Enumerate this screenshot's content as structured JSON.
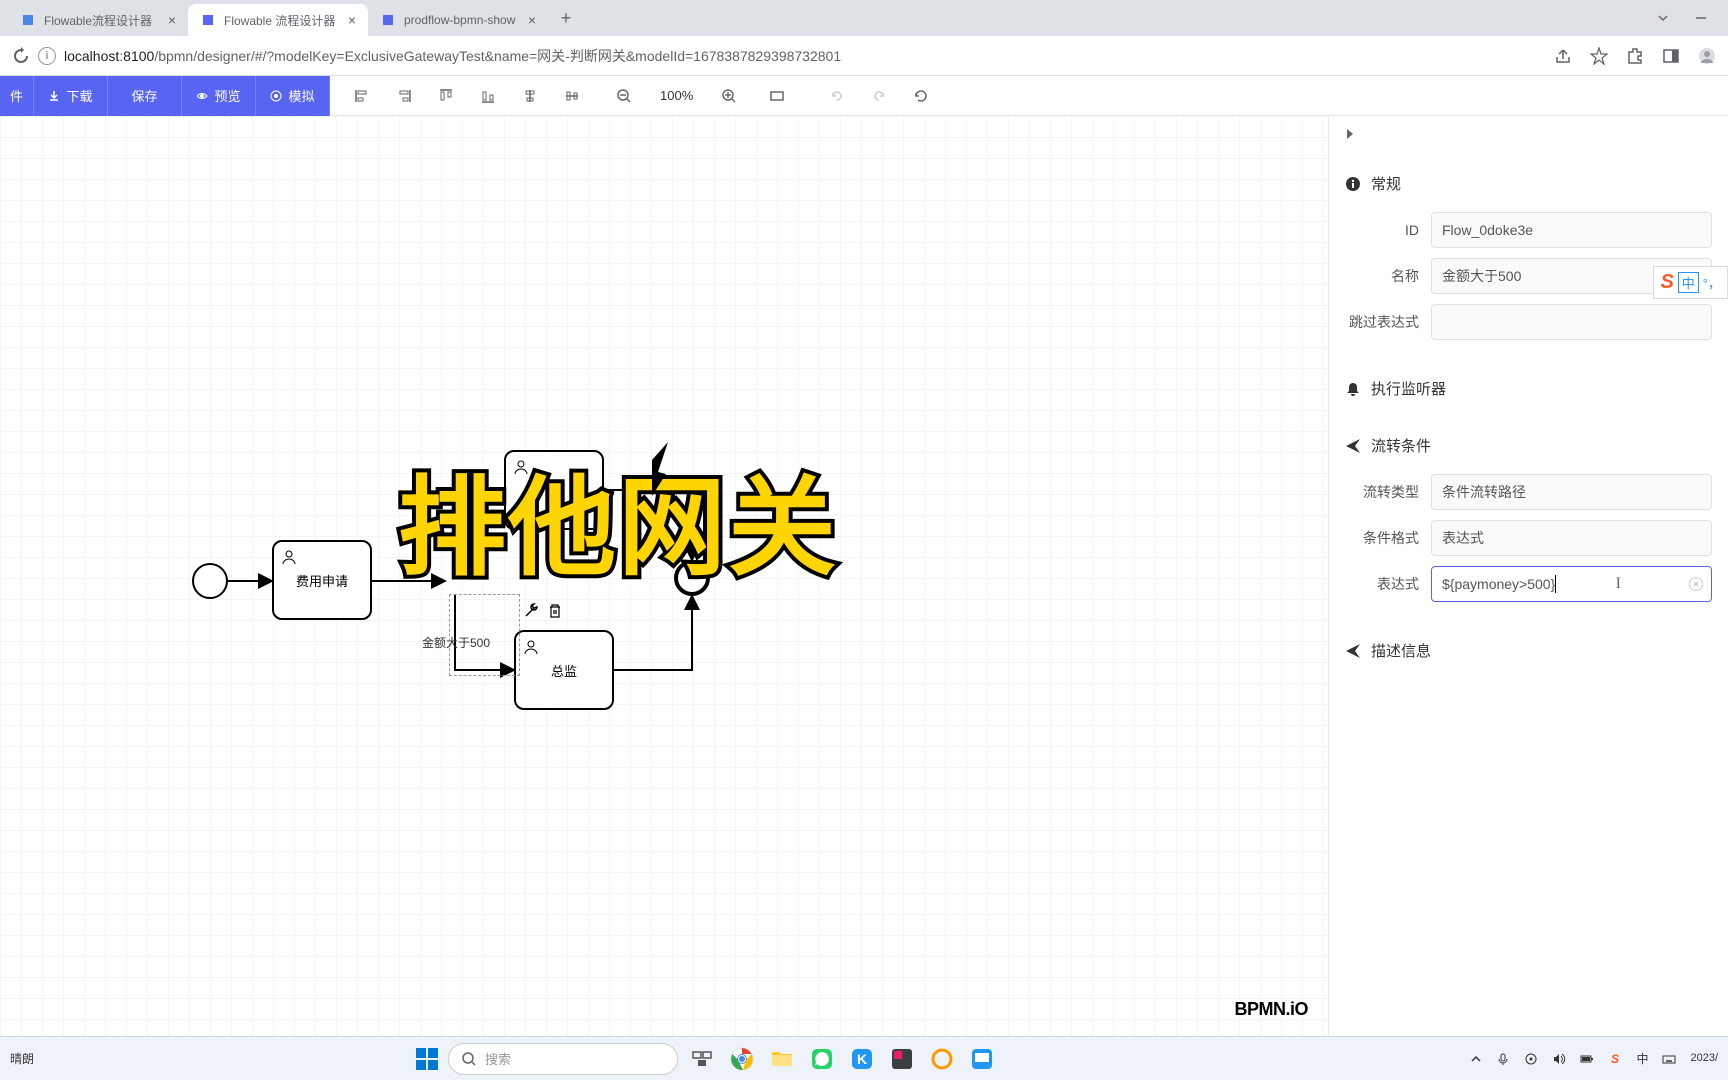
{
  "tabs": [
    {
      "title": "Flowable流程设计器",
      "active": false
    },
    {
      "title": "Flowable 流程设计器",
      "active": true
    },
    {
      "title": "prodflow-bpmn-show",
      "active": false
    }
  ],
  "url": {
    "host": "localhost",
    "port": "8100",
    "rest": "/bpmn/designer/#/?modelKey=ExclusiveGatewayTest&name=网关-判断网关&modelId=1678387829398732801"
  },
  "toolbar": {
    "file": "件",
    "download": "下载",
    "save": "保存",
    "preview": "预览",
    "simulate": "模拟",
    "zoom": "100%"
  },
  "bpmn": {
    "task1": "费用申请",
    "task2_upper": "",
    "task3": "总监",
    "flow_label": "金额大于500",
    "logo": "BPMN.iO"
  },
  "overlay": "排他网关",
  "properties": {
    "section_general": "常规",
    "id_label": "ID",
    "id_value": "Flow_0doke3e",
    "name_label": "名称",
    "name_value": "金额大于500",
    "skip_expr_label": "跳过表达式",
    "skip_expr_value": "",
    "section_listeners": "执行监听器",
    "section_condition": "流转条件",
    "flow_type_label": "流转类型",
    "flow_type_value": "条件流转路径",
    "cond_format_label": "条件格式",
    "cond_format_value": "表达式",
    "expr_label": "表达式",
    "expr_value": "${paymoney>500}",
    "section_desc": "描述信息"
  },
  "ime": {
    "zh": "中"
  },
  "taskbar": {
    "weather": "晴朗",
    "search_placeholder": "搜索",
    "date": "2023/"
  }
}
